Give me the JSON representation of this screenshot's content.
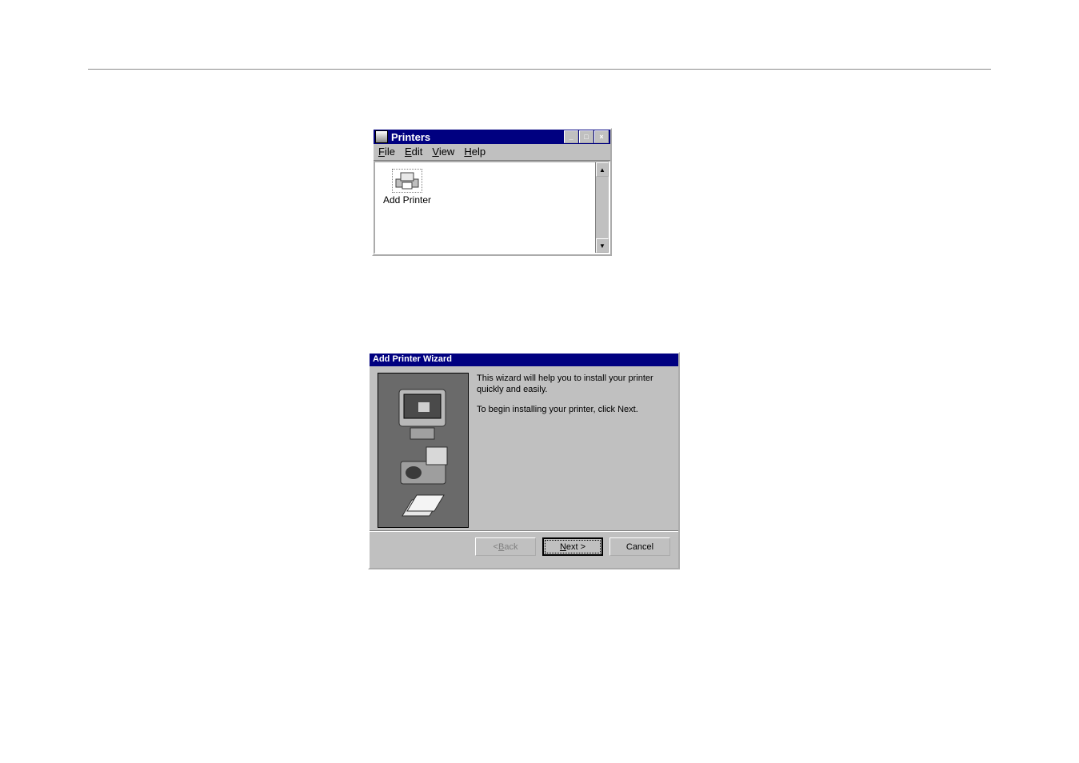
{
  "printers_window": {
    "title": "Printers",
    "menu": {
      "file": "File",
      "edit": "Edit",
      "view": "View",
      "help": "Help"
    },
    "item_label": "Add Printer",
    "win_controls": {
      "minimize_glyph": "_",
      "maximize_glyph": "□",
      "close_glyph": "×"
    },
    "scroll": {
      "up_glyph": "▲",
      "down_glyph": "▼"
    }
  },
  "wizard": {
    "title": "Add Printer Wizard",
    "line1": "This wizard will help you to install your printer quickly and easily.",
    "line2": "To begin installing your printer, click Next.",
    "buttons": {
      "back": "< Back",
      "next": "Next >",
      "cancel": "Cancel"
    }
  }
}
